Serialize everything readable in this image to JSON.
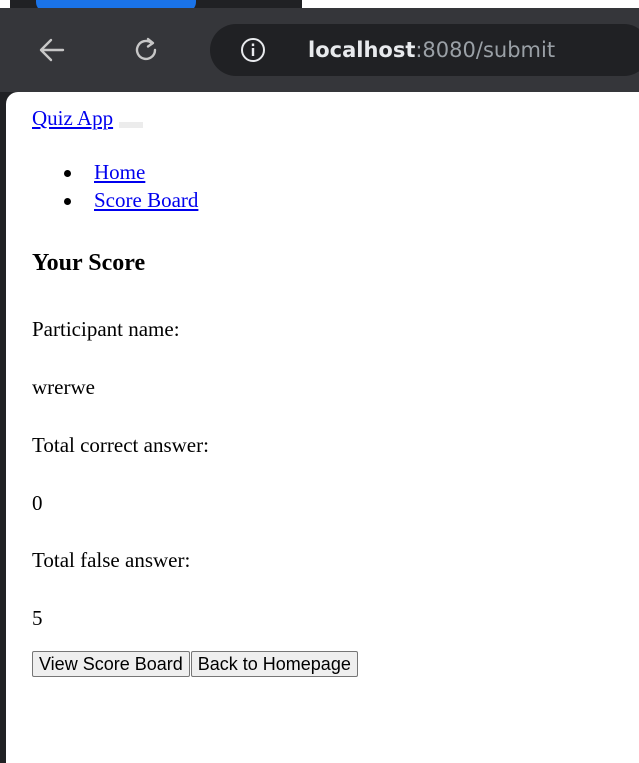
{
  "browser": {
    "url_host": "localhost",
    "url_rest": ":8080/submit"
  },
  "navbar": {
    "brand": "Quiz App",
    "links": [
      "Home",
      "Score Board"
    ]
  },
  "score": {
    "title": "Your Score",
    "participant_label": "Participant name:",
    "participant_value": "wrerwe",
    "correct_label": "Total correct answer:",
    "correct_value": "0",
    "false_label": "Total false answer:",
    "false_value": "5"
  },
  "actions": {
    "view_score_board": "View Score Board",
    "back_to_homepage": "Back to Homepage"
  },
  "colors": {
    "toolbar": "#35363a",
    "omnibox": "#202124",
    "link": "#0000ee"
  },
  "icons": [
    "back-arrow-icon",
    "reload-icon",
    "info-icon"
  ]
}
